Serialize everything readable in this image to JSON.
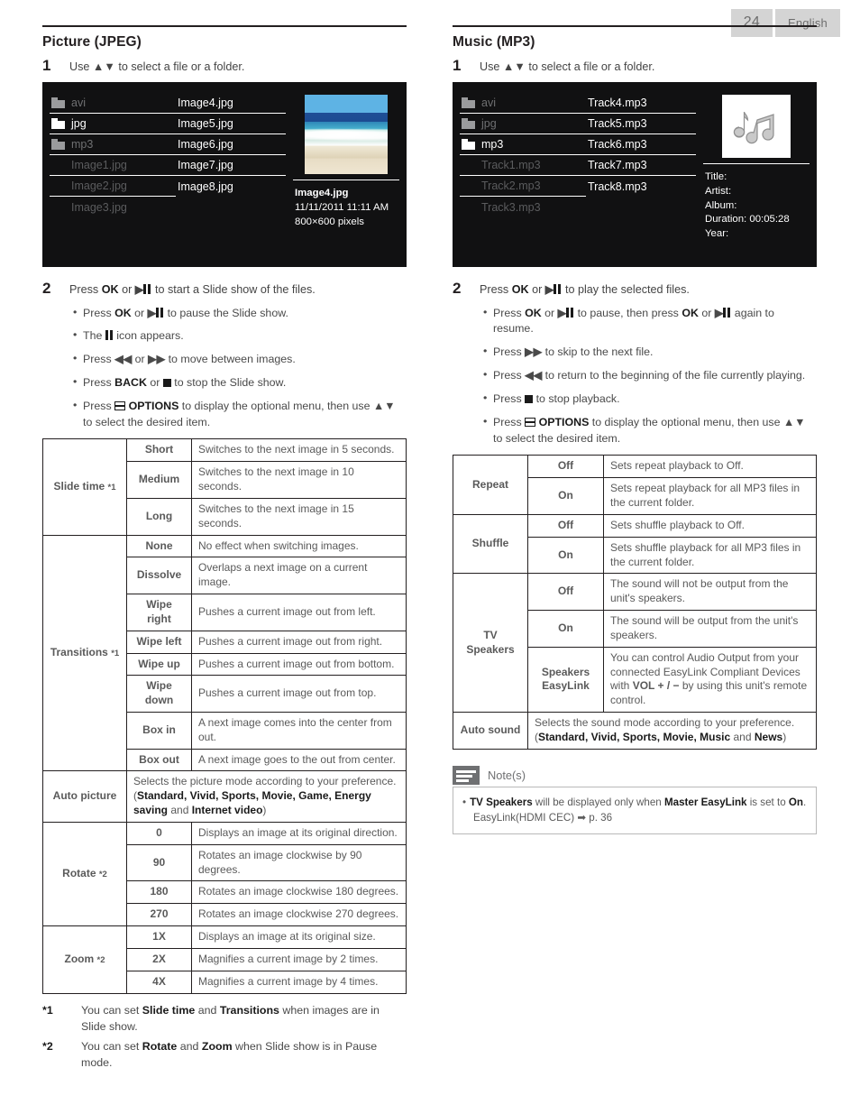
{
  "header": {
    "page_number": "24",
    "language": "English"
  },
  "left": {
    "title": "Picture (JPEG)",
    "step1": {
      "num": "1",
      "text_before": "Use ",
      "text_after": " to select a file or a folder."
    },
    "screen": {
      "col1": [
        {
          "label": "avi",
          "icon": "folder-icon",
          "dim": true,
          "underline": true
        },
        {
          "label": "jpg",
          "icon": "folder-icon",
          "dim": false,
          "underline": true
        },
        {
          "label": "mp3",
          "icon": "folder-icon",
          "dim": true,
          "underline": true
        },
        {
          "label": "Image1.jpg",
          "icon": "",
          "dim": true,
          "underline": true
        },
        {
          "label": "Image2.jpg",
          "icon": "",
          "dim": true,
          "underline": true
        },
        {
          "label": "Image3.jpg",
          "icon": "",
          "dim": true,
          "underline": false
        }
      ],
      "col2": [
        {
          "label": "Image4.jpg",
          "underline": true
        },
        {
          "label": "Image5.jpg",
          "underline": true
        },
        {
          "label": "Image6.jpg",
          "underline": true
        },
        {
          "label": "Image7.jpg",
          "underline": true
        },
        {
          "label": "Image8.jpg",
          "underline": false
        }
      ],
      "preview_icon": "beach-photo-thumbnail",
      "meta": {
        "name": "Image4.jpg",
        "date": "11/11/2011 11:11 AM",
        "dimensions": "800×600 pixels"
      }
    },
    "step2": {
      "num": "2",
      "text": "Press OK or ▶❙❙ to start a Slide show of the files."
    },
    "bullets": [
      "Press OK or ▶❙❙ to pause the Slide show.",
      "The ❙❙ icon appears.",
      "Press ◀◀ or ▶▶ to move between images.",
      "Press BACK or ■ to stop the Slide show.",
      "Press ☰ OPTIONS to display the optional menu, then use ▲▼ to select the desired item."
    ],
    "table": {
      "groups": [
        {
          "name": "Slide time",
          "note": "*1",
          "rows": [
            {
              "option": "Short",
              "desc": "Switches to the next image in 5 seconds."
            },
            {
              "option": "Medium",
              "desc": "Switches to the next image in 10 seconds."
            },
            {
              "option": "Long",
              "desc": "Switches to the next image in 15 seconds."
            }
          ]
        },
        {
          "name": "Transitions",
          "note": "*1",
          "rows": [
            {
              "option": "None",
              "desc": "No effect when switching images."
            },
            {
              "option": "Dissolve",
              "desc": "Overlaps a next image on a current image."
            },
            {
              "option": "Wipe right",
              "desc": "Pushes a current image out from left."
            },
            {
              "option": "Wipe left",
              "desc": "Pushes a current image out from right."
            },
            {
              "option": "Wipe up",
              "desc": "Pushes a current image out from bottom."
            },
            {
              "option": "Wipe down",
              "desc": "Pushes a current image out from top."
            },
            {
              "option": "Box in",
              "desc": "A next image comes into the center from out."
            },
            {
              "option": "Box out",
              "desc": "A next image goes to the out from center."
            }
          ]
        }
      ],
      "auto_picture": {
        "name": "Auto picture",
        "desc_part1": "Selects the picture mode according to your preference. (",
        "modes": "Standard, Vivid, Sports, Movie, Game, Energy saving",
        "desc_mid": " and ",
        "mode_last": "Internet video",
        "desc_end": ")"
      },
      "rotate": {
        "name": "Rotate",
        "note": "*2",
        "rows": [
          {
            "option": "0",
            "desc": "Displays an image at its original direction."
          },
          {
            "option": "90",
            "desc": "Rotates an image clockwise by 90 degrees."
          },
          {
            "option": "180",
            "desc": "Rotates an image clockwise 180 degrees."
          },
          {
            "option": "270",
            "desc": "Rotates an image clockwise 270 degrees."
          }
        ]
      },
      "zoom": {
        "name": "Zoom",
        "note": "*2",
        "rows": [
          {
            "option": "1X",
            "desc": "Displays an image at its original size."
          },
          {
            "option": "2X",
            "desc": "Magnifies a current image by 2 times."
          },
          {
            "option": "4X",
            "desc": "Magnifies a current image by 4 times."
          }
        ]
      }
    },
    "footnotes": [
      {
        "mark": "*1",
        "text": "You can set Slide time and Transitions when images are in Slide show."
      },
      {
        "mark": "*2",
        "text": "You can set Rotate and Zoom when Slide show is in Pause mode."
      }
    ]
  },
  "right": {
    "title": "Music (MP3)",
    "step1": {
      "num": "1",
      "text_before": "Use ",
      "text_after": " to select a file or a folder."
    },
    "screen": {
      "col1": [
        {
          "label": "avi",
          "icon": "folder-icon",
          "dim": true,
          "underline": true
        },
        {
          "label": "jpg",
          "icon": "folder-icon",
          "dim": true,
          "underline": true
        },
        {
          "label": "mp3",
          "icon": "folder-icon",
          "dim": false,
          "underline": true
        },
        {
          "label": "Track1.mp3",
          "icon": "",
          "dim": true,
          "underline": true
        },
        {
          "label": "Track2.mp3",
          "icon": "",
          "dim": true,
          "underline": true
        },
        {
          "label": "Track3.mp3",
          "icon": "",
          "dim": true,
          "underline": false
        }
      ],
      "col2": [
        {
          "label": "Track4.mp3",
          "underline": true
        },
        {
          "label": "Track5.mp3",
          "underline": true
        },
        {
          "label": "Track6.mp3",
          "underline": true
        },
        {
          "label": "Track7.mp3",
          "underline": true
        },
        {
          "label": "Track8.mp3",
          "underline": false
        }
      ],
      "preview_icon": "music-note-thumbnail",
      "meta": {
        "title": "Title:",
        "artist": "Artist:",
        "album": "Album:",
        "duration": "Duration: 00:05:28",
        "year": "Year:"
      }
    },
    "step2": {
      "num": "2",
      "text": "Press OK or ▶❙❙ to play the selected files."
    },
    "bullets": [
      "Press OK or ▶❙❙ to pause, then press OK or ▶❙❙ again to resume.",
      "Press ▶▶ to skip to the next file.",
      "Press ◀◀ to return to the beginning of the file currently playing.",
      "Press ■ to stop playback.",
      "Press ☰ OPTIONS to display the optional menu, then use ▲▼ to select the desired item."
    ],
    "table": {
      "repeat": {
        "name": "Repeat",
        "rows": [
          {
            "option": "Off",
            "desc": "Sets repeat playback to Off."
          },
          {
            "option": "On",
            "desc": "Sets repeat playback for all MP3 files in the current folder."
          }
        ]
      },
      "shuffle": {
        "name": "Shuffle",
        "rows": [
          {
            "option": "Off",
            "desc": "Sets shuffle playback to Off."
          },
          {
            "option": "On",
            "desc": "Sets shuffle playback for all MP3 files in the current folder."
          }
        ]
      },
      "tv_speakers": {
        "name": "TV Speakers",
        "rows": [
          {
            "option": "Off",
            "desc": "The sound will not be output from the unit's speakers."
          },
          {
            "option": "On",
            "desc": "The sound will be output from the unit's speakers."
          },
          {
            "option": "Speakers EasyLink",
            "desc_part1": "You can control Audio Output from your connected EasyLink Compliant Devices with ",
            "bold": "VOL + / −",
            "desc_part2": " by using this unit's remote control."
          }
        ]
      },
      "auto_sound": {
        "name": "Auto sound",
        "desc_part1": "Selects the sound mode according to your preference. (",
        "modes": "Standard, Vivid, Sports, Movie, Music",
        "desc_mid": " and ",
        "mode_last": "News",
        "desc_end": ")"
      }
    },
    "notes": {
      "label": "Note(s)",
      "icon": "note-lines-icon",
      "line1_a": "TV Speakers",
      "line1_b": " will be displayed only when ",
      "line1_c": "Master EasyLink",
      "line1_d": " is set to ",
      "line1_e": "On",
      "line1_f": ".",
      "line2_a": "EasyLink(HDMI CEC)",
      "line2_arrow": "➡",
      "line2_b": "p. 36"
    }
  }
}
